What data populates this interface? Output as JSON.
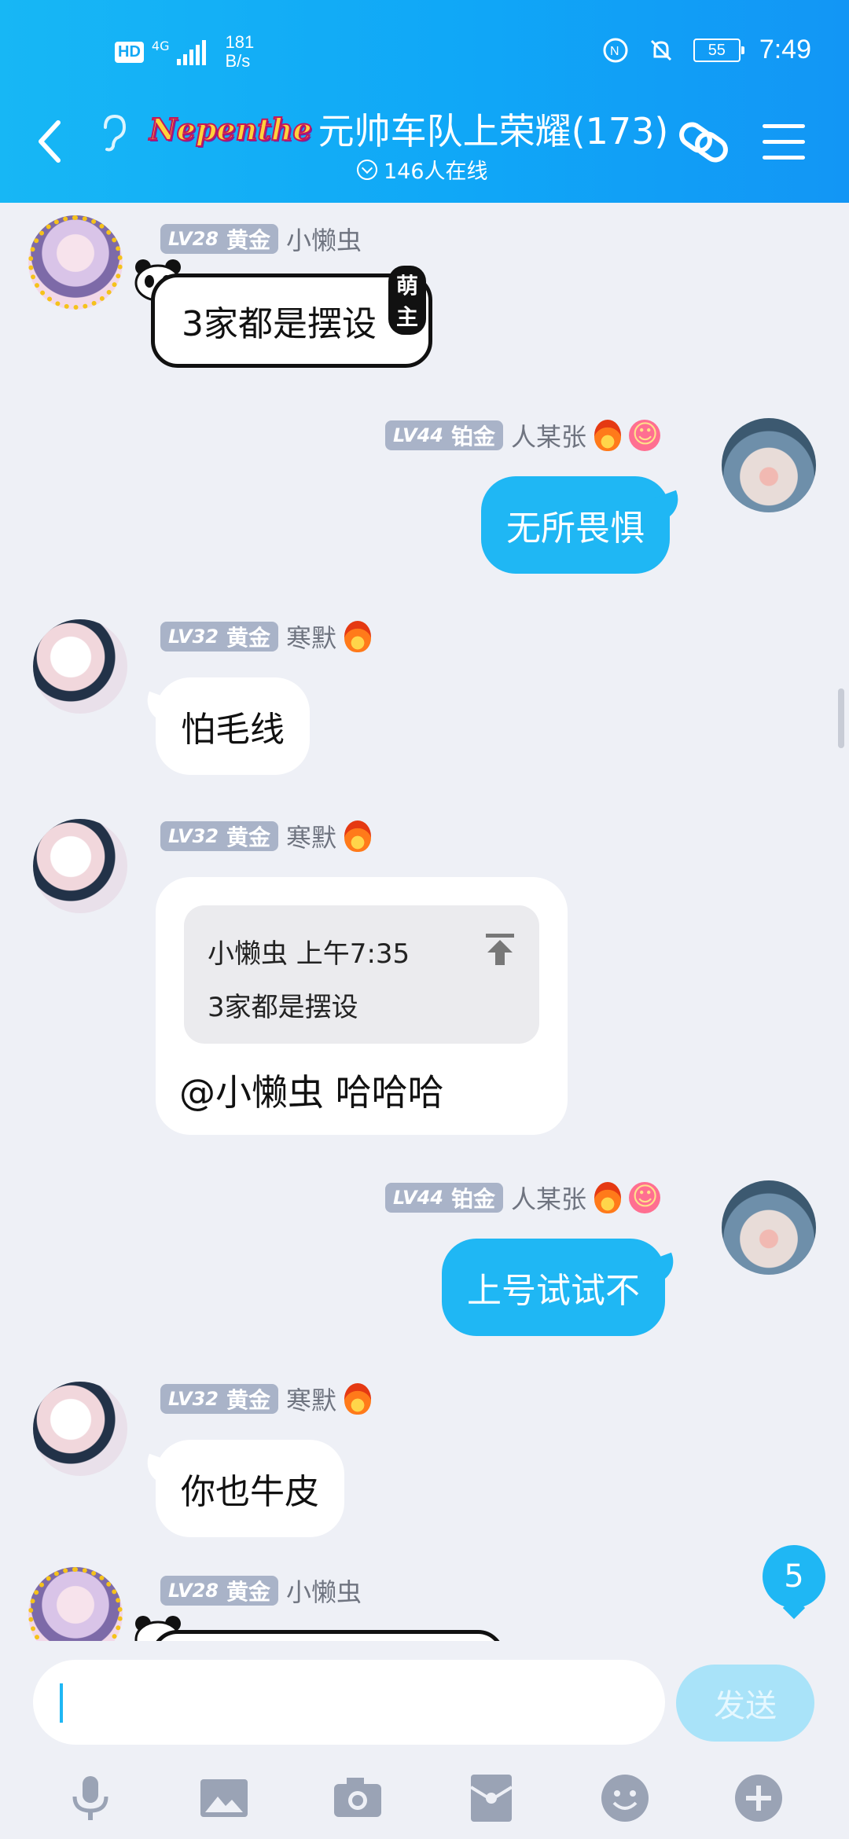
{
  "status_bar": {
    "hd": "HD",
    "network": "4G",
    "speed_value": "181",
    "speed_unit": "B/s",
    "battery": "55",
    "time": "7:49"
  },
  "header": {
    "brand": "Nepenthe",
    "title": "元帅车队上荣耀(173)",
    "online": "146人在线"
  },
  "messages": [
    {
      "level": "LV28",
      "rank": "黄金",
      "name": "小懒虫",
      "text": "3家都是摆设",
      "tag": "萌主"
    },
    {
      "level": "LV44",
      "rank": "铂金",
      "name": "人某张",
      "text": "无所畏惧"
    },
    {
      "level": "LV32",
      "rank": "黄金",
      "name": "寒默",
      "text": "怕毛线"
    },
    {
      "level": "LV32",
      "rank": "黄金",
      "name": "寒默",
      "quote_head": "小懒虫 上午7:35",
      "quote_body": "3家都是摆设",
      "text": "@小懒虫 哈哈哈"
    },
    {
      "level": "LV44",
      "rank": "铂金",
      "name": "人某张",
      "text": "上号试试不"
    },
    {
      "level": "LV32",
      "rank": "黄金",
      "name": "寒默",
      "text": "你也牛皮"
    },
    {
      "level": "LV28",
      "rank": "黄金",
      "name": "小懒虫"
    }
  ],
  "unread_count": "5",
  "input": {
    "value": "",
    "send_label": "发送"
  },
  "colors": {
    "header": "#12a8f5",
    "accent": "#1fb7f4",
    "background": "#eef0f6"
  }
}
